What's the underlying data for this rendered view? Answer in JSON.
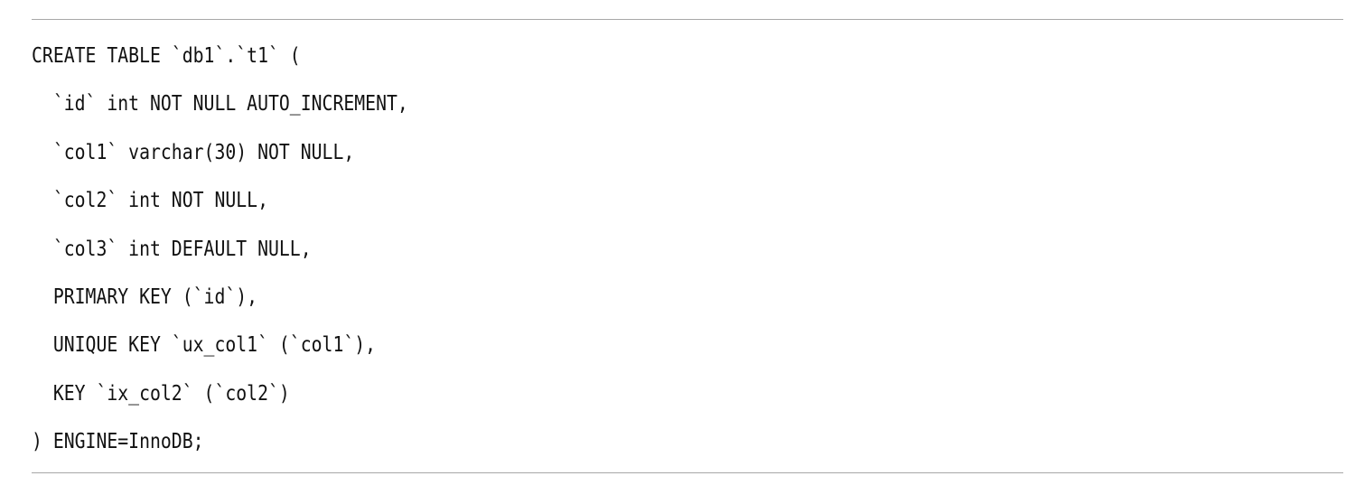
{
  "code": {
    "lines": [
      "CREATE TABLE `db1`.`t1` (",
      "  `id` int NOT NULL AUTO_INCREMENT,",
      "  `col1` varchar(30) NOT NULL,",
      "  `col2` int NOT NULL,",
      "  `col3` int DEFAULT NULL,",
      "  PRIMARY KEY (`id`),",
      "  UNIQUE KEY `ux_col1` (`col1`),",
      "  KEY `ix_col2` (`col2`)",
      ") ENGINE=InnoDB;"
    ]
  }
}
